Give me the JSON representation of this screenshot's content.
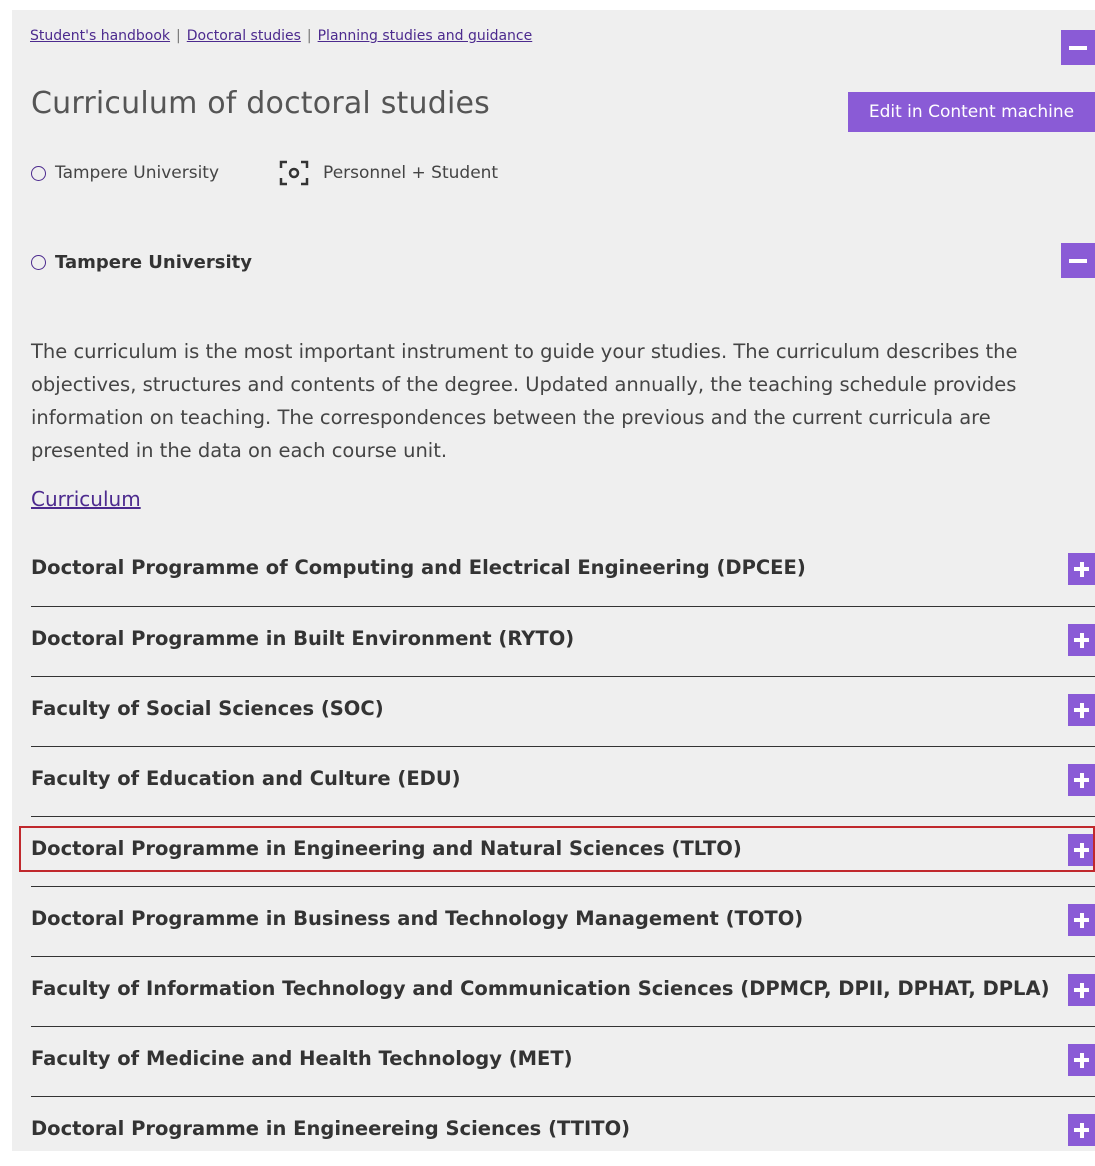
{
  "breadcrumb": [
    {
      "label": "Student's handbook"
    },
    {
      "label": "Doctoral studies"
    },
    {
      "label": "Planning studies and guidance"
    }
  ],
  "breadcrumb_separator": "|",
  "page": {
    "title": "Curriculum of doctoral studies",
    "edit_button": "Edit in Content machine"
  },
  "meta": {
    "organization": "Tampere University",
    "audience": "Personnel + Student"
  },
  "section": {
    "heading": "Tampere University",
    "intro": "The curriculum is the most important instrument to guide your studies. The curriculum describes the objectives, structures and contents of the degree. Updated annually, the teaching schedule provides information on teaching. The correspondences between the previous and the current curricula are presented in the data on each course unit.",
    "link": "Curriculum"
  },
  "programmes": [
    {
      "label": "Doctoral Programme of Computing and Electrical Engineering (DPCEE)"
    },
    {
      "label": "Doctoral Programme in Built Environment (RYTO)"
    },
    {
      "label": "Faculty of Social Sciences (SOC)"
    },
    {
      "label": "Faculty of Education and Culture (EDU)"
    },
    {
      "label": "Doctoral Programme in Engineering and Natural Sciences (TLTO)"
    },
    {
      "label": "Doctoral Programme in Business and Technology Management (TOTO)"
    },
    {
      "label": "Faculty of Information Technology and Communication Sciences (DPMCP, DPII, DPHAT, DPLA)"
    },
    {
      "label": "Faculty of Medicine and Health Technology (MET)"
    },
    {
      "label": "Doctoral Programme in Engineereing Sciences (TTITO)"
    }
  ],
  "colors": {
    "accent": "#8a5bd6",
    "link": "#4c2a8e",
    "highlight": "#c0282d",
    "panel": "#efefef"
  }
}
